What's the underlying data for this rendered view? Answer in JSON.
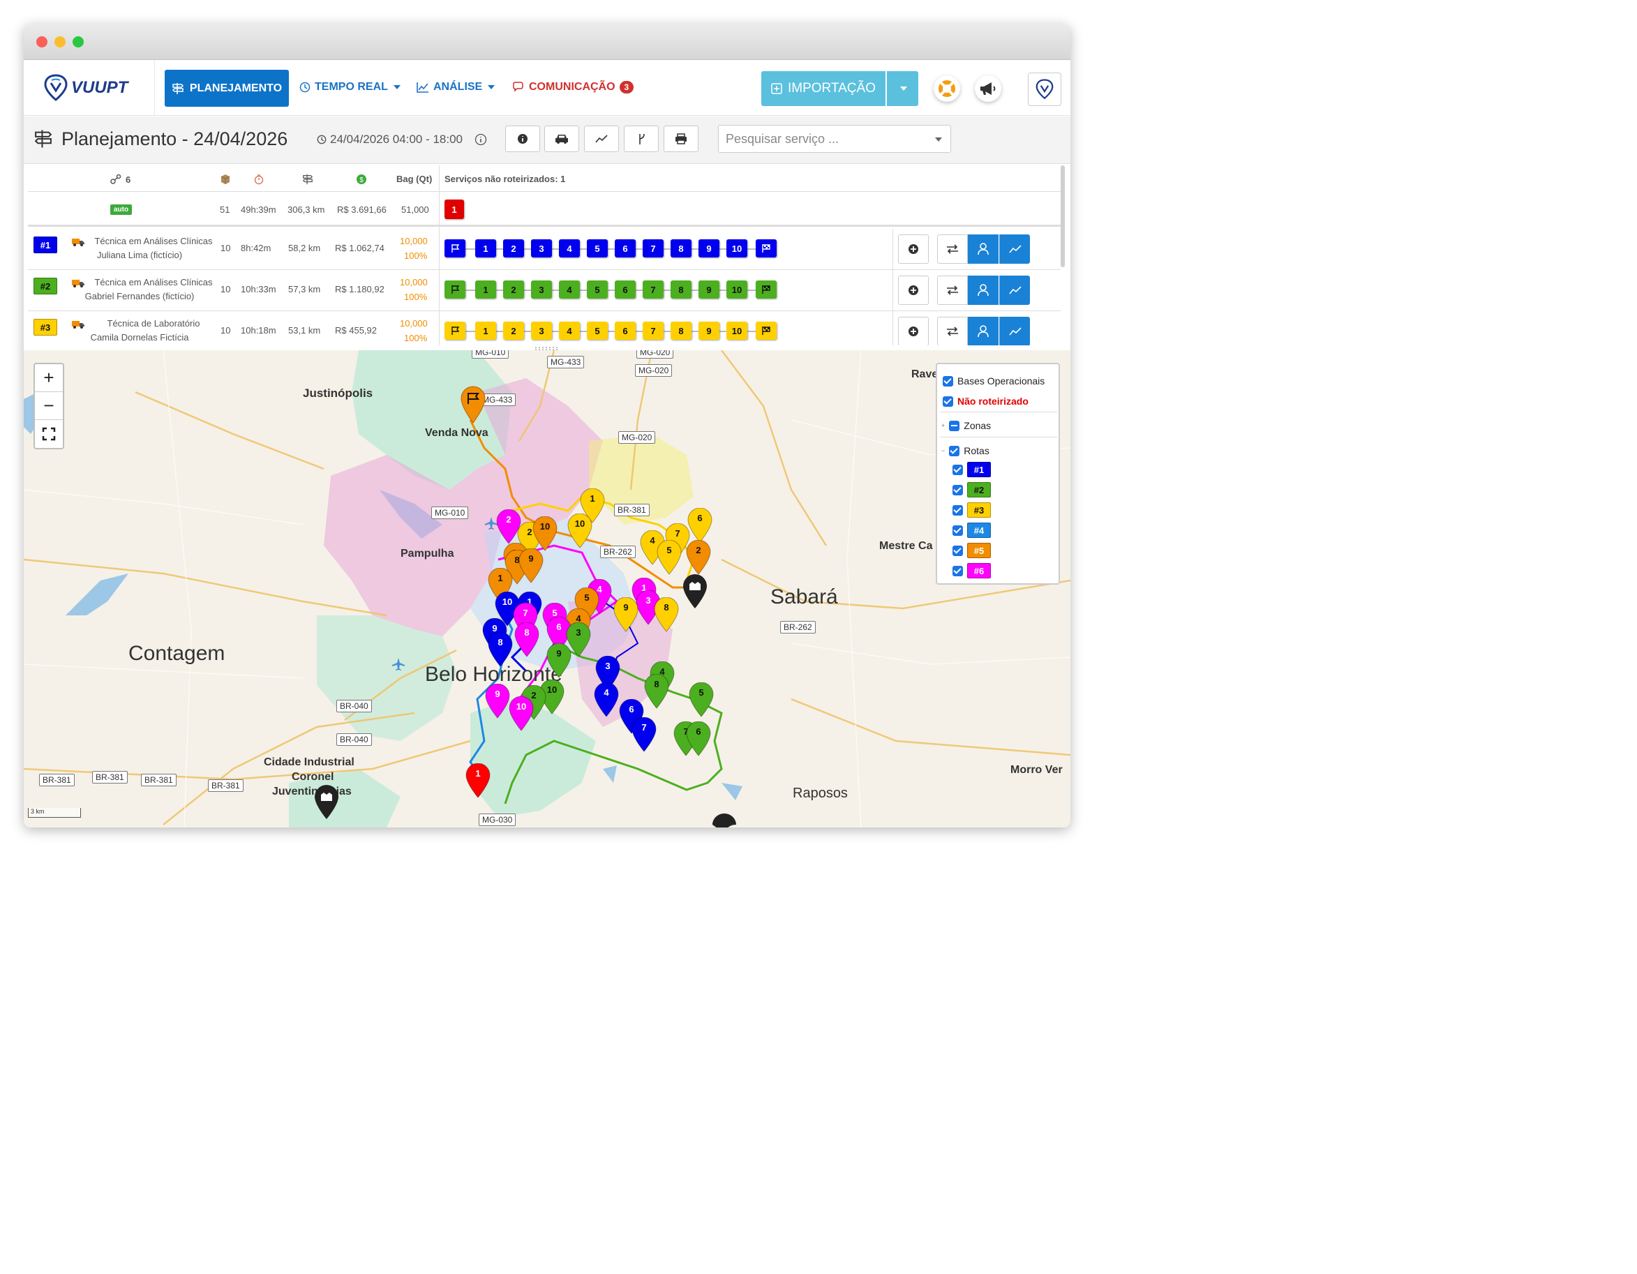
{
  "app": {
    "logo_text": "VUUPT"
  },
  "nav": {
    "planejamento": "PLANEJAMENTO",
    "tempo_real": "TEMPO REAL",
    "analise": "ANÁLISE",
    "comunicacao": "COMUNICAÇÃO",
    "comunicacao_count": "3",
    "importacao": "IMPORTAÇÃO"
  },
  "header": {
    "title": "Planejamento - 24/04/2026",
    "period": "24/04/2026 04:00 - 18:00",
    "search_placeholder": "Pesquisar serviço ..."
  },
  "summary": {
    "vehicles": "6",
    "bag_header": "Bag (Qt)",
    "unrouted_label": "Serviços não roteirizados: 1",
    "auto_badge": "auto",
    "total_services": "51",
    "total_time": "49h:39m",
    "total_distance": "306,3 km",
    "total_cost": "R$ 3.691,66",
    "total_bag": "51,000",
    "unrouted_stop": "1"
  },
  "routes": [
    {
      "id": "#1",
      "color": "#0000ee",
      "text_color": "#ffffff",
      "role": "Técnica em Análises Clínicas",
      "driver": "Juliana Lima (fictício)",
      "services": "10",
      "time": "8h:42m",
      "distance": "58,2 km",
      "cost": "R$ 1.062,74",
      "bag": "10,000",
      "pct": "100%",
      "stops": [
        "1",
        "2",
        "3",
        "4",
        "5",
        "6",
        "7",
        "8",
        "9",
        "10"
      ]
    },
    {
      "id": "#2",
      "color": "#4caf1f",
      "text_color": "#111111",
      "role": "Técnica em Análises Clínicas",
      "driver": "Gabriel Fernandes (fictício)",
      "services": "10",
      "time": "10h:33m",
      "distance": "57,3 km",
      "cost": "R$ 1.180,92",
      "bag": "10,000",
      "pct": "100%",
      "stops": [
        "1",
        "2",
        "3",
        "4",
        "5",
        "6",
        "7",
        "8",
        "9",
        "10"
      ]
    },
    {
      "id": "#3",
      "color": "#ffd000",
      "text_color": "#111111",
      "role": "Técnica de Laboratório",
      "driver": "Camila Dornelas Fictícia",
      "services": "10",
      "time": "10h:18m",
      "distance": "53,1 km",
      "cost": "R$ 455,92",
      "bag": "10,000",
      "pct": "100%",
      "stops": [
        "1",
        "2",
        "3",
        "4",
        "5",
        "6",
        "7",
        "8",
        "9",
        "10"
      ]
    }
  ],
  "map": {
    "places": {
      "justinopolis": "Justinópolis",
      "venda_nova": "Venda Nova",
      "pampulha": "Pampulha",
      "contagem": "Contagem",
      "belo_horizonte": "Belo Horizonte",
      "sabara": "Sabará",
      "mestre_ca": "Mestre Ca",
      "rave": "Rave",
      "cidade_industrial": "Cidade Industrial",
      "coronel": "Coronel",
      "juventino": "Juventino Dias",
      "raposos": "Raposos",
      "morro": "Morro Ver"
    },
    "road_labels": [
      "MG-010",
      "MG-433",
      "MG-020",
      "MG-433",
      "MG-020",
      "MG-010",
      "BR-381",
      "BR-262",
      "BR-262",
      "BR-040",
      "BR-040",
      "BR-381",
      "BR-381",
      "BR-381",
      "BR-381",
      "MG-030"
    ],
    "scale_label": "3 km",
    "legend": {
      "bases": "Bases Operacionais",
      "nao_roteirizado": "Não roteirizado",
      "zonas": "Zonas",
      "rotas": "Rotas",
      "routes": [
        {
          "label": "#1",
          "color": "#0000ee"
        },
        {
          "label": "#2",
          "color": "#4caf1f"
        },
        {
          "label": "#3",
          "color": "#ffd000"
        },
        {
          "label": "#4",
          "color": "#1e88e5"
        },
        {
          "label": "#5",
          "color": "#f28c00"
        },
        {
          "label": "#6",
          "color": "#ff00ff"
        }
      ]
    },
    "markers": [
      {
        "n": "2",
        "c": "#ff00ff"
      },
      {
        "n": "1",
        "c": "#ffd000"
      },
      {
        "n": "10",
        "c": "#ffd000"
      },
      {
        "n": "6",
        "c": "#ffd000"
      },
      {
        "n": "7",
        "c": "#ffd000"
      },
      {
        "n": "4",
        "c": "#ffd000"
      },
      {
        "n": "5",
        "c": "#ffd000"
      },
      {
        "n": "2",
        "c": "#f28c00"
      },
      {
        "n": "2",
        "c": "#ffd000"
      },
      {
        "n": "10",
        "c": "#f28c00"
      },
      {
        "n": "7",
        "c": "#f28c00"
      },
      {
        "n": "8",
        "c": "#f28c00"
      },
      {
        "n": "9",
        "c": "#f28c00"
      },
      {
        "n": "1",
        "c": "#f28c00"
      },
      {
        "n": "10",
        "c": "#0000ee"
      },
      {
        "n": "1",
        "c": "#0000ee"
      },
      {
        "n": "4",
        "c": "#ff00ff"
      },
      {
        "n": "5",
        "c": "#f28c00"
      },
      {
        "n": "1",
        "c": "#ff00ff"
      },
      {
        "n": "3",
        "c": "#ff00ff"
      },
      {
        "n": "9",
        "c": "#ffd000"
      },
      {
        "n": "8",
        "c": "#ffd000"
      },
      {
        "n": "7",
        "c": "#ff00ff"
      },
      {
        "n": "5",
        "c": "#ff00ff"
      },
      {
        "n": "4",
        "c": "#f28c00"
      },
      {
        "n": "6",
        "c": "#ff00ff"
      },
      {
        "n": "8",
        "c": "#ff00ff"
      },
      {
        "n": "3",
        "c": "#4caf1f"
      },
      {
        "n": "9",
        "c": "#0000ee"
      },
      {
        "n": "8",
        "c": "#0000ee"
      },
      {
        "n": "9",
        "c": "#4caf1f"
      },
      {
        "n": "3",
        "c": "#0000ee"
      },
      {
        "n": "4",
        "c": "#4caf1f"
      },
      {
        "n": "8",
        "c": "#4caf1f"
      },
      {
        "n": "5",
        "c": "#4caf1f"
      },
      {
        "n": "4",
        "c": "#0000ee"
      },
      {
        "n": "10",
        "c": "#4caf1f"
      },
      {
        "n": "2",
        "c": "#4caf1f"
      },
      {
        "n": "9",
        "c": "#ff00ff"
      },
      {
        "n": "10",
        "c": "#ff00ff"
      },
      {
        "n": "6",
        "c": "#0000ee"
      },
      {
        "n": "7",
        "c": "#0000ee"
      },
      {
        "n": "7",
        "c": "#4caf1f"
      },
      {
        "n": "6",
        "c": "#4caf1f"
      },
      {
        "n": "1",
        "c": "#ff0000"
      }
    ]
  }
}
